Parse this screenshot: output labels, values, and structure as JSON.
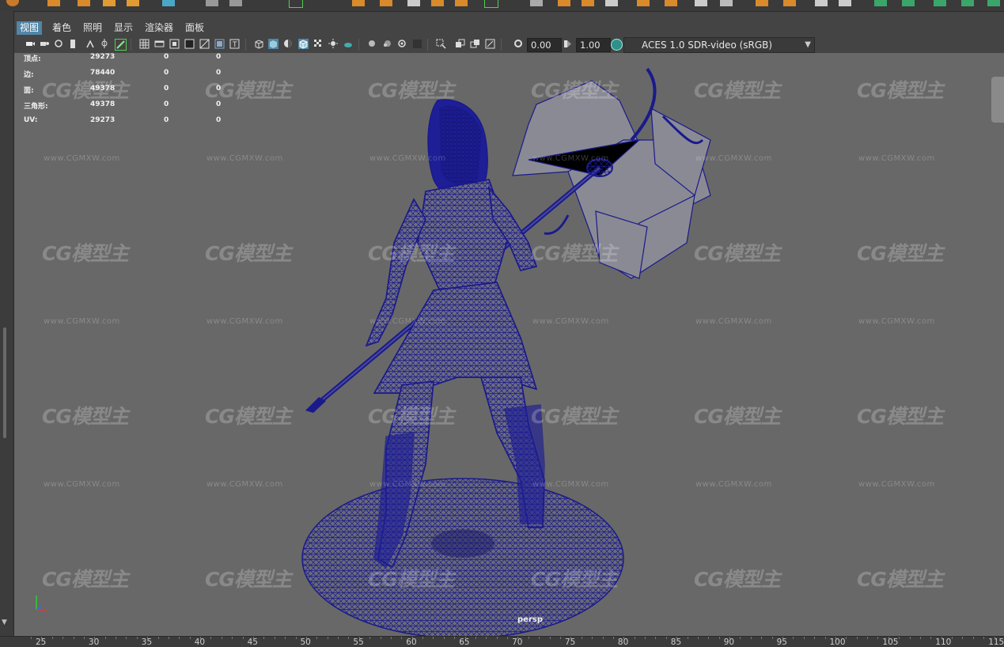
{
  "panel_menu": {
    "items": [
      "视图",
      "着色",
      "照明",
      "显示",
      "渲染器",
      "面板"
    ],
    "active_index": 0
  },
  "toolbar": {
    "exposure_value": "0.00",
    "gamma_value": "1.00",
    "color_space": "ACES 1.0 SDR-video (sRGB)"
  },
  "hud": {
    "rows": [
      {
        "label": "顶点:",
        "v1": "29273",
        "v2": "0",
        "v3": "0"
      },
      {
        "label": "边:",
        "v1": "78440",
        "v2": "0",
        "v3": "0"
      },
      {
        "label": "面:",
        "v1": "49378",
        "v2": "0",
        "v3": "0"
      },
      {
        "label": "三角形:",
        "v1": "49378",
        "v2": "0",
        "v3": "0"
      },
      {
        "label": "UV:",
        "v1": "29273",
        "v2": "0",
        "v3": "0"
      }
    ]
  },
  "viewport": {
    "camera_label": "persp",
    "wireframe_color": "#1a1a8c",
    "background_color": "#686868"
  },
  "watermark": {
    "logo_text": "CG模型主",
    "url_text": "www.CGMXW.com"
  },
  "ruler": {
    "labels": [
      "25",
      "30",
      "35",
      "40",
      "45",
      "50",
      "55",
      "60",
      "65",
      "70",
      "75",
      "80",
      "85",
      "90",
      "95",
      "100",
      "105",
      "110",
      "115"
    ]
  },
  "colors": {
    "accent": "#5285a6",
    "ui_background": "#444444",
    "viewport_background": "#686868"
  }
}
